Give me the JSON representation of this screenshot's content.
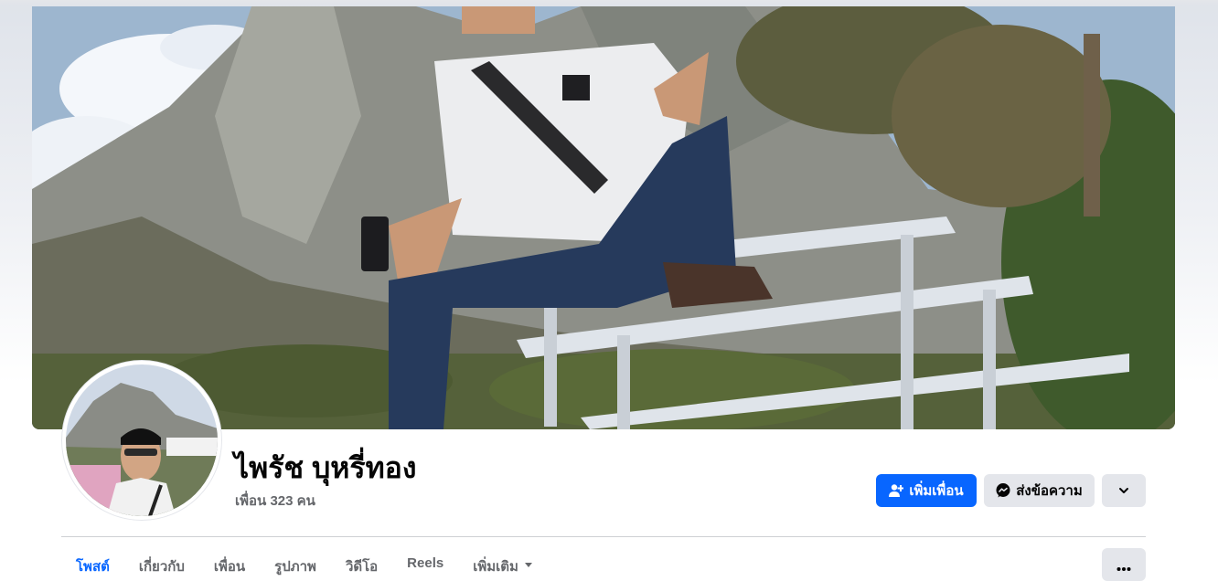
{
  "profile": {
    "name": "ไพรัช บุหรี่ทอง",
    "friends_text": "เพื่อน 323 คน"
  },
  "actions": {
    "add_friend": "เพิ่มเพื่อน",
    "message": "ส่งข้อความ"
  },
  "tabs": [
    {
      "label": "โพสต์",
      "active": true
    },
    {
      "label": "เกี่ยวกับ",
      "active": false
    },
    {
      "label": "เพื่อน",
      "active": false
    },
    {
      "label": "รูปภาพ",
      "active": false
    },
    {
      "label": "วิดีโอ",
      "active": false
    },
    {
      "label": "Reels",
      "active": false
    },
    {
      "label": "เพิ่มเติม",
      "active": false
    }
  ],
  "icons": {
    "add_friend": "add-person-icon",
    "message": "messenger-icon",
    "dropdown": "chevron-down-icon",
    "more": "more-dots-icon"
  },
  "colors": {
    "accent": "#0866ff",
    "secondary_button": "#e4e6eb",
    "text_primary": "#050505",
    "text_secondary": "#65676b"
  }
}
